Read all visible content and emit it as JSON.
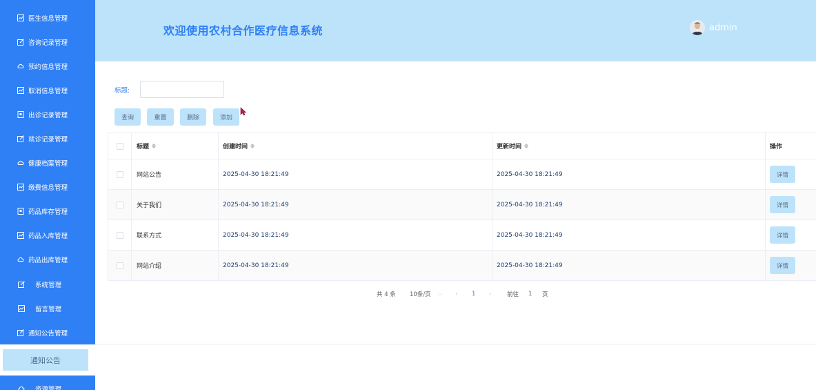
{
  "sidebar": {
    "items": [
      {
        "label": "医生信息管理",
        "icon": "chart-icon"
      },
      {
        "label": "咨询记录管理",
        "icon": "edit-icon"
      },
      {
        "label": "预约信息管理",
        "icon": "cloud-icon"
      },
      {
        "label": "取消信息管理",
        "icon": "chart-icon"
      },
      {
        "label": "出诊记录管理",
        "icon": "document-icon"
      },
      {
        "label": "就诊记录管理",
        "icon": "edit-icon"
      },
      {
        "label": "健康档案管理",
        "icon": "cloud-icon"
      },
      {
        "label": "缴费信息管理",
        "icon": "chart-icon"
      },
      {
        "label": "药品库存管理",
        "icon": "document-icon"
      },
      {
        "label": "药品入库管理",
        "icon": "chart-icon"
      },
      {
        "label": "药品出库管理",
        "icon": "cloud-icon"
      },
      {
        "label": "系统管理",
        "icon": "edit-icon"
      },
      {
        "label": "留言管理",
        "icon": "chart-icon"
      },
      {
        "label": "通知公告管理",
        "icon": "edit-icon"
      }
    ],
    "sub_item": "通知公告",
    "last_item": {
      "label": "资源管理",
      "icon": "cloud-icon"
    }
  },
  "header": {
    "title": "欢迎使用农村合作医疗信息系统",
    "username": "admin"
  },
  "filter": {
    "label": "标题:",
    "value": "",
    "placeholder": ""
  },
  "buttons": {
    "query": "查询",
    "reset": "重置",
    "delete": "删除",
    "add": "添加"
  },
  "table": {
    "headers": {
      "title": "标题",
      "created": "创建时间",
      "updated": "更新时间",
      "actions": "操作"
    },
    "rows": [
      {
        "title": "网站公告",
        "created": "2025-04-30 18:21:49",
        "updated": "2025-04-30 18:21:49",
        "action": "详情"
      },
      {
        "title": "关于我们",
        "created": "2025-04-30 18:21:49",
        "updated": "2025-04-30 18:21:49",
        "action": "详情"
      },
      {
        "title": "联系方式",
        "created": "2025-04-30 18:21:49",
        "updated": "2025-04-30 18:21:49",
        "action": "详情"
      },
      {
        "title": "网站介绍",
        "created": "2025-04-30 18:21:49",
        "updated": "2025-04-30 18:21:49",
        "action": "详情"
      }
    ]
  },
  "pagination": {
    "total": "共 4 条",
    "page_size": "10条/页",
    "current_page": "1",
    "goto_label": "前往",
    "goto_value": "1",
    "page_suffix": "页"
  },
  "colors": {
    "sidebar_bg": "#2f7ff5",
    "header_bg": "#bde3fb",
    "accent": "#2f7ff5"
  }
}
